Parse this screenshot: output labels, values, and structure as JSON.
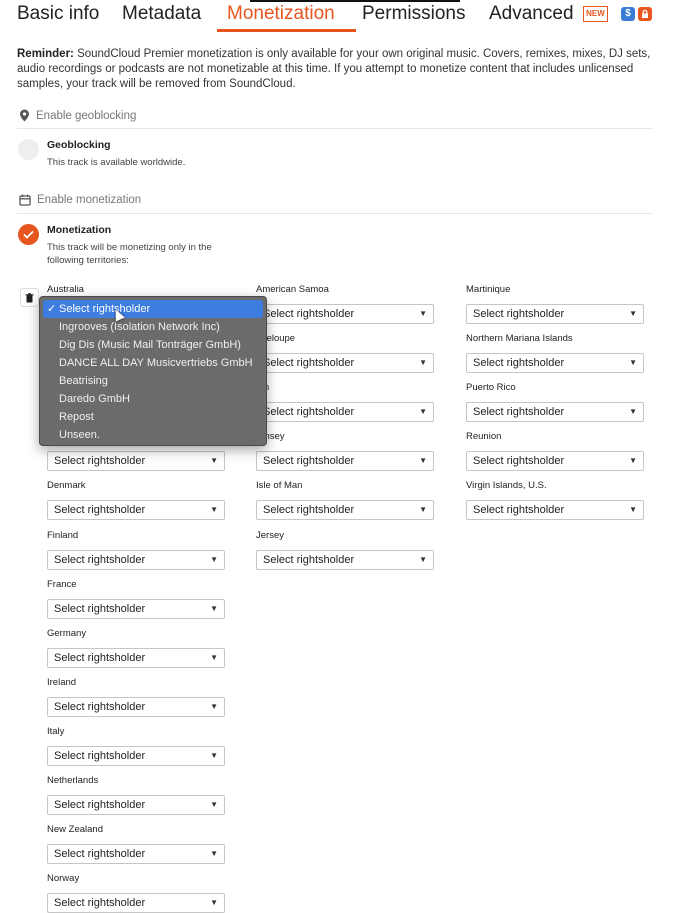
{
  "tabs": [
    {
      "label": "Basic info"
    },
    {
      "label": "Metadata"
    },
    {
      "label": "Monetization"
    },
    {
      "label": "Permissions"
    },
    {
      "label": "Advanced"
    }
  ],
  "badges": {
    "new": "NEW",
    "dollar": "$",
    "lock": "🔒"
  },
  "reminder": {
    "lead": "Reminder:",
    "text": " SoundCloud Premier monetization is only available for your own original music. Covers, remixes, mixes, DJ sets, audio recordings or podcasts are not monetizable at this time. If you attempt to monetize content that includes unlicensed samples, your track will be removed from SoundCloud."
  },
  "geoblocking": {
    "header": "Enable geoblocking",
    "title": "Geoblocking",
    "desc": "This track is available worldwide."
  },
  "monetization": {
    "header": "Enable monetization",
    "title": "Monetization",
    "desc": "This track will be monetizing only in the following territories:"
  },
  "select_placeholder": "Select rightsholder",
  "columns": [
    [
      "Australia",
      "",
      "",
      "",
      "Denmark",
      "Finland",
      "France",
      "Germany",
      "Ireland",
      "Italy",
      "Netherlands",
      "New Zealand",
      "Norway"
    ],
    [
      "American Samoa",
      "adeloupe",
      "am",
      "ernsey",
      "Isle of Man",
      "Jersey"
    ],
    [
      "Martinique",
      "Northern Mariana Islands",
      "Puerto Rico",
      "Reunion",
      "Virgin Islands, U.S."
    ]
  ],
  "dropdown": {
    "options": [
      "Select rightsholder",
      "Ingrooves (Isolation Network Inc)",
      "Dig Dis (Music Mail Tonträger GmbH)",
      "DANCE ALL DAY Musicvertriebs GmbH",
      "Beatrising",
      "Daredo GmbH",
      "Repost",
      "Unseen."
    ],
    "selected_index": 0
  }
}
